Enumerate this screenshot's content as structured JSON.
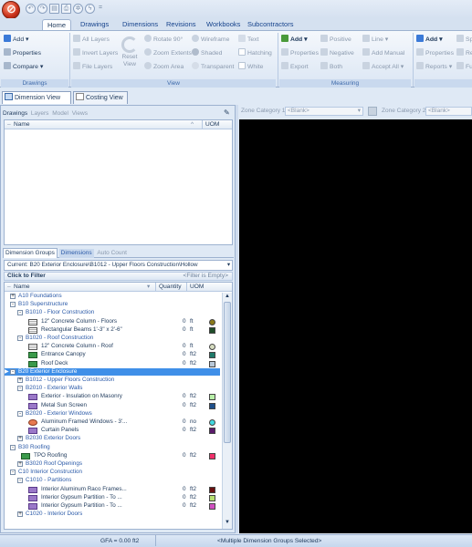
{
  "quick_access": {
    "title_sep": "="
  },
  "ribbon_tabs": [
    "Home",
    "Drawings",
    "Dimensions",
    "Revisions",
    "Workbooks",
    "Subcontractors"
  ],
  "ribbon": {
    "drawings": {
      "add": "Add",
      "properties": "Properties",
      "compare": "Compare",
      "group": "Drawings"
    },
    "view": {
      "all_layers": "All Layers",
      "invert_layers": "Invert Layers",
      "file_layers": "File Layers",
      "reset": "Reset View",
      "rotate": "Rotate 90°",
      "zoom_extents": "Zoom Extents",
      "zoom_area": "Zoom Area",
      "wireframe": "Wireframe",
      "shaded": "Shaded",
      "transparent": "Transparent",
      "text": "Text",
      "hatching": "Hatching",
      "white": "White",
      "group": "View"
    },
    "measuring": {
      "add": "Add",
      "properties": "Properties",
      "export": "Export",
      "positive": "Positive",
      "negative": "Negative",
      "both": "Both",
      "line": "Line",
      "add_manual": "Add Manual",
      "accept_all": "Accept All",
      "group": "Measuring"
    },
    "extra": {
      "add": "Add",
      "properties": "Properties",
      "reports": "Reports",
      "sp": "Sp",
      "re": "Re",
      "fu": "Fu"
    }
  },
  "view_tabs": [
    "Dimension View",
    "Costing View"
  ],
  "drawings_panel": {
    "tabs": [
      "Drawings",
      "Layers",
      "Model",
      "Views"
    ],
    "col_name": "Name",
    "col_uom": "UOM"
  },
  "groups_panel": {
    "tabs": [
      "Dimension Groups",
      "Dimensions",
      "Auto Count"
    ],
    "current": "Current: B20 Exterior Enclosure\\B1012 - Upper Floors Construction\\Hollow",
    "click_to_filter": "Click to Filter",
    "filter_status": "<Filter is Empty>",
    "col_name": "Name",
    "col_qty": "Quantity",
    "col_uom": "UOM"
  },
  "tree": [
    {
      "lvl": 0,
      "type": "group",
      "box": "+",
      "label": "A10 Foundations"
    },
    {
      "lvl": 0,
      "type": "group",
      "box": "-",
      "label": "B10 Superstructure"
    },
    {
      "lvl": 1,
      "type": "group",
      "box": "-",
      "label": "B1010 - Floor Construction"
    },
    {
      "lvl": 2,
      "type": "item",
      "icon": "beam",
      "label": "12\" Concrete Column - Floors",
      "qty": "0",
      "uom": "ft",
      "color": "#8a7a1a",
      "shape": "circle"
    },
    {
      "lvl": 2,
      "type": "item",
      "icon": "beam",
      "label": "Rectangular Beams 1'-3\" x 2'-6\"",
      "qty": "0",
      "uom": "ft",
      "color": "#1f4d2a",
      "shape": "square"
    },
    {
      "lvl": 1,
      "type": "group",
      "box": "-",
      "label": "B1020 - Roof Construction"
    },
    {
      "lvl": 2,
      "type": "item",
      "icon": "beam",
      "label": "12\" Concrete Column - Roof",
      "qty": "0",
      "uom": "ft",
      "color": "#d6dcc0",
      "shape": "circle"
    },
    {
      "lvl": 2,
      "type": "item",
      "icon": "area-green",
      "label": "Entrance Canopy",
      "qty": "0",
      "uom": "ft2",
      "color": "#1e7a6a",
      "shape": "square"
    },
    {
      "lvl": 2,
      "type": "item",
      "icon": "area-green",
      "label": "Roof Deck",
      "qty": "0",
      "uom": "ft2",
      "color": "#b8c8d8",
      "shape": "square"
    },
    {
      "lvl": 0,
      "type": "group",
      "box": "-",
      "label": "B20 Exterior Enclosure",
      "selected": true
    },
    {
      "lvl": 1,
      "type": "group",
      "box": "+",
      "label": "B1012 - Upper Floors Construction"
    },
    {
      "lvl": 1,
      "type": "group",
      "box": "-",
      "label": "B2010 - Exterior Walls"
    },
    {
      "lvl": 2,
      "type": "item",
      "icon": "area-purple",
      "label": "Exterior - Insulation on Masonry",
      "qty": "0",
      "uom": "ft2",
      "color": "#b8f0a8",
      "shape": "square"
    },
    {
      "lvl": 2,
      "type": "item",
      "icon": "area-purple",
      "label": "Metal Sun Screen",
      "qty": "0",
      "uom": "ft2",
      "color": "#1e4f8a",
      "shape": "square"
    },
    {
      "lvl": 1,
      "type": "group",
      "box": "-",
      "label": "B2020 - Exterior Windows"
    },
    {
      "lvl": 2,
      "type": "item",
      "icon": "count",
      "label": "Aluminum Framed Windows - 3'...",
      "qty": "0",
      "uom": "no",
      "color": "#40d8e0",
      "shape": "circle"
    },
    {
      "lvl": 2,
      "type": "item",
      "icon": "area-purple",
      "label": "Curtain Panels",
      "qty": "0",
      "uom": "ft2",
      "color": "#5a1a6a",
      "shape": "square"
    },
    {
      "lvl": 1,
      "type": "group",
      "box": "+",
      "label": "B2030 Exterior Doors"
    },
    {
      "lvl": 0,
      "type": "group",
      "box": "-",
      "label": "B30 Roofing"
    },
    {
      "lvl": 1,
      "type": "item",
      "icon": "area-green",
      "label": "TPO Roofing",
      "qty": "0",
      "uom": "ft2",
      "color": "#f0306a",
      "shape": "square"
    },
    {
      "lvl": 1,
      "type": "group",
      "box": "+",
      "label": "B3020 Roof Openings"
    },
    {
      "lvl": 0,
      "type": "group",
      "box": "-",
      "label": "C10 Interior Construction"
    },
    {
      "lvl": 1,
      "type": "group",
      "box": "-",
      "label": "C1010 - Partitions"
    },
    {
      "lvl": 2,
      "type": "item",
      "icon": "area-purple",
      "label": "Interior Aluminum Raco Frames...",
      "qty": "0",
      "uom": "ft2",
      "color": "#6a1010",
      "shape": "square"
    },
    {
      "lvl": 2,
      "type": "item",
      "icon": "area-purple",
      "label": "Interior Gypsum Partition - To ...",
      "qty": "0",
      "uom": "ft2",
      "color": "#b8e070",
      "shape": "square"
    },
    {
      "lvl": 2,
      "type": "item",
      "icon": "area-purple",
      "label": "Interior Gypsum Partition - To ...",
      "qty": "0",
      "uom": "ft2",
      "color": "#d050c0",
      "shape": "square"
    },
    {
      "lvl": 1,
      "type": "group",
      "box": "+",
      "label": "C1020 - Interior Doors"
    }
  ],
  "zone_bar": {
    "zone1_label": "Zone Category 1:",
    "zone1_value": "<Blank>",
    "zone2_label": "Zone Category 2:",
    "zone2_value": "<Blank>"
  },
  "status": {
    "gfa": "GFA = 0.00 ft2",
    "selection": "<Multiple Dimension Groups Selected>"
  },
  "colors": {
    "canvas": "#000000",
    "selection": "#3f8fe8",
    "accent": "#15428b"
  }
}
